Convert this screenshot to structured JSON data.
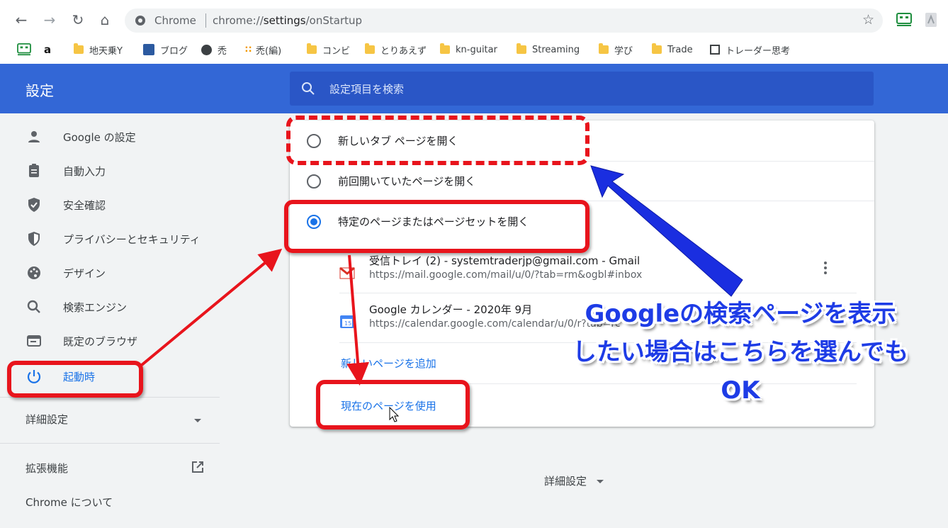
{
  "browser": {
    "site_name": "Chrome",
    "url_prefix": "chrome://",
    "url_path": "settings",
    "url_suffix": "/onStartup"
  },
  "bookmarks": [
    {
      "label": "",
      "icon": "app-icon"
    },
    {
      "label": "",
      "icon": "amazon-icon"
    },
    {
      "label": "地天乗Y",
      "icon": "folder-icon"
    },
    {
      "label": "ブログ",
      "icon": "blog-icon"
    },
    {
      "label": "禿",
      "icon": "globe-icon"
    },
    {
      "label": "禿(編)",
      "icon": "ameba-icon"
    },
    {
      "label": "コンビ",
      "icon": "folder-icon"
    },
    {
      "label": "とりあえず",
      "icon": "folder-icon"
    },
    {
      "label": "kn-guitar",
      "icon": "folder-icon"
    },
    {
      "label": "Streaming",
      "icon": "folder-icon"
    },
    {
      "label": "学び",
      "icon": "folder-icon"
    },
    {
      "label": "Trade",
      "icon": "folder-icon"
    },
    {
      "label": "トレーダー思考",
      "icon": "trader-icon"
    }
  ],
  "header": {
    "title": "設定",
    "search_placeholder": "設定項目を検索"
  },
  "sidebar": {
    "items": [
      {
        "label": "Google の設定",
        "icon": "person-icon"
      },
      {
        "label": "自動入力",
        "icon": "clipboard-icon"
      },
      {
        "label": "安全確認",
        "icon": "shield-check-icon"
      },
      {
        "label": "プライバシーとセキュリティ",
        "icon": "shield-icon"
      },
      {
        "label": "デザイン",
        "icon": "palette-icon"
      },
      {
        "label": "検索エンジン",
        "icon": "search-icon"
      },
      {
        "label": "既定のブラウザ",
        "icon": "browser-icon"
      },
      {
        "label": "起動時",
        "icon": "power-icon"
      }
    ],
    "advanced": "詳細設定",
    "extensions": "拡張機能",
    "about": "Chrome について"
  },
  "startup": {
    "options": [
      {
        "label": "新しいタブ ページを開く",
        "checked": false
      },
      {
        "label": "前回開いていたページを開く",
        "checked": false
      },
      {
        "label": "特定のページまたはページセットを開く",
        "checked": true
      }
    ],
    "pages": [
      {
        "title": "受信トレイ (2) - systemtraderjp@gmail.com - Gmail",
        "url": "https://mail.google.com/mail/u/0/?tab=rm&ogbl#inbox"
      },
      {
        "title": "Google カレンダー - 2020年 9月",
        "url": "https://calendar.google.com/calendar/u/0/r?tab=rc"
      }
    ],
    "add_page": "新しいページを追加",
    "use_current": "現在のページを使用"
  },
  "footer": {
    "advanced": "詳細設定"
  },
  "annotation": {
    "lines": [
      "Googleの検索ページを表示",
      "したい場合はこちらを選んでも",
      "OK"
    ],
    "colors": {
      "highlight": "#e8141c",
      "callout_text": "#1e3ce6",
      "arrow_blue": "#1a2ee0"
    }
  }
}
